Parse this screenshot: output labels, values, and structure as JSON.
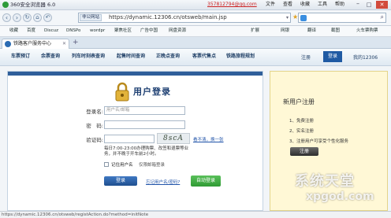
{
  "window": {
    "title": "360安全浏览器 6.0",
    "user_email": "357812794@qq.com",
    "menus": [
      "文件",
      "查看",
      "收藏",
      "工具",
      "帮助"
    ]
  },
  "address": {
    "zone": "非公网站",
    "url": "https://dynamic.12306.cn/otsweb/main.jsp",
    "search_placeholder": ""
  },
  "favorites": {
    "items": [
      "收藏",
      "百度",
      "Discuz",
      "DNSPo",
      "wordpr",
      "聚焦社区",
      "广告中国",
      "网盘资源"
    ],
    "right_items": [
      "扩展",
      "网银",
      "翻译",
      "截图",
      "火车票购票"
    ]
  },
  "tabs": [
    {
      "label": "铁路客户服务中心"
    }
  ],
  "site": {
    "nav": [
      "车票预订",
      "余票查询",
      "列车时刻表查询",
      "起售时间查询",
      "正晚点查询",
      "客票代售点",
      "铁路旅程规划"
    ],
    "top_links": {
      "register": "注册",
      "login": "登录",
      "mine": "我的12306"
    }
  },
  "login": {
    "title": "用户登录",
    "username_label": "登录名:",
    "username_placeholder": "用户名/邮箱",
    "password_label": "密　码:",
    "captcha_label": "验证码:",
    "captcha_text": "8scA",
    "captcha_refresh": "看不清，换一张",
    "notice": "每日7:00-23:00办理购票、改签和退票等业务，并不晚于开车前2小时。",
    "remember_label": "记住用户名",
    "remember_desc": "仅限邮箱登录",
    "login_button": "登录",
    "forgot_link": "忘记用户名/密码?",
    "auto_login_button": "自动登录"
  },
  "register": {
    "title": "新用户注册",
    "steps": [
      "1、免费注册",
      "2、实名注册",
      "3、注册用户可享受个性化服务"
    ],
    "button": "注册"
  },
  "status": {
    "text": "https://dynamic.12306.cn/otsweb/registAction.do?method=initNote"
  },
  "watermark": {
    "text": "系统天堂",
    "sub": "xpgod.com"
  }
}
